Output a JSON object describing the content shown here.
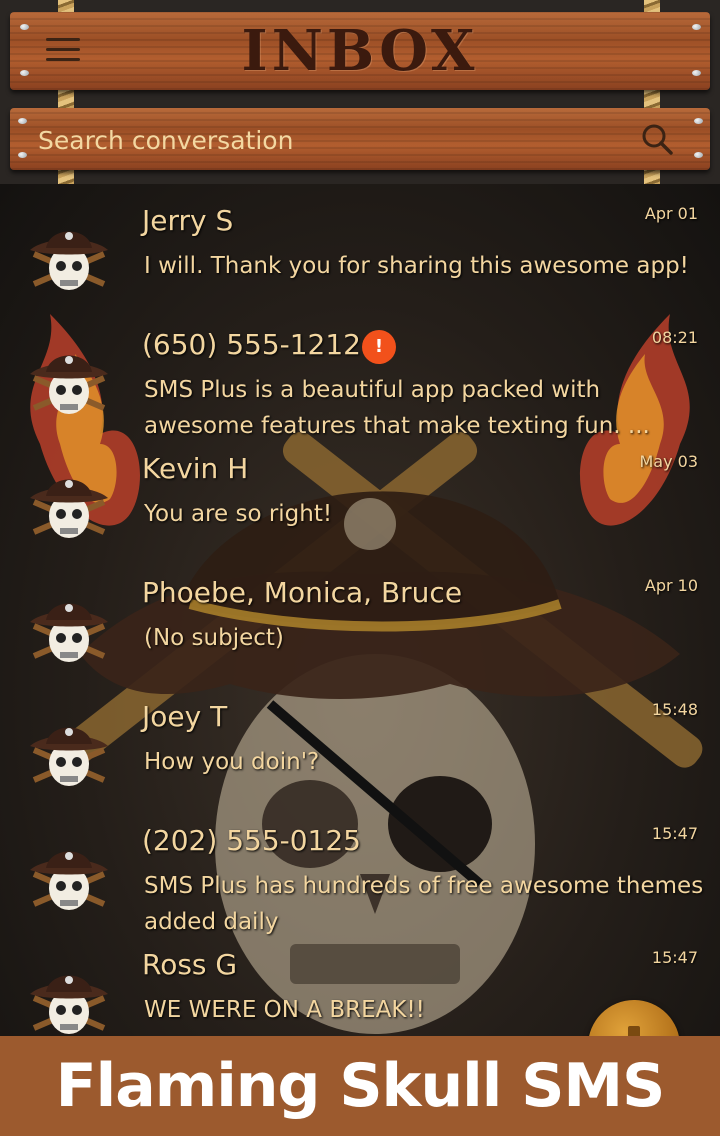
{
  "header": {
    "title": "INBOX",
    "search_placeholder": "Search conversation"
  },
  "conversations": [
    {
      "name": "Jerry S",
      "time": "Apr 01",
      "snippet": " I will. Thank you for sharing this awesome app!",
      "error": false
    },
    {
      "name": "(650) 555-1212",
      "time": "08:21",
      "snippet": "SMS Plus is a beautiful app packed with awesome features that make texting fun. ...",
      "error": true,
      "error_label": "!"
    },
    {
      "name": "Kevin H",
      "time": "May 03",
      "snippet": "You are so right!",
      "error": false
    },
    {
      "name": "Phoebe, Monica, Bruce",
      "time": "Apr 10",
      "snippet": "(No subject)",
      "error": false
    },
    {
      "name": "Joey T",
      "time": "15:48",
      "snippet": " How you doin'?",
      "error": false
    },
    {
      "name": "(202) 555-0125",
      "time": "15:47",
      "snippet": " SMS Plus has hundreds of free awesome themes added daily",
      "error": false
    },
    {
      "name": "Ross G",
      "time": "15:47",
      "snippet": " WE WERE ON A BREAK!!",
      "error": false
    }
  ],
  "banner": {
    "text": "Flaming Skull SMS"
  },
  "colors": {
    "plank": "#9c4f26",
    "text": "#f3d6a0",
    "banner": "#9c5a2e",
    "badge": "#f2511b"
  },
  "icons": {
    "menu": "hamburger-menu-icon",
    "search": "search-icon",
    "avatar": "pirate-skull-avatar",
    "compose": "compose-icon"
  }
}
